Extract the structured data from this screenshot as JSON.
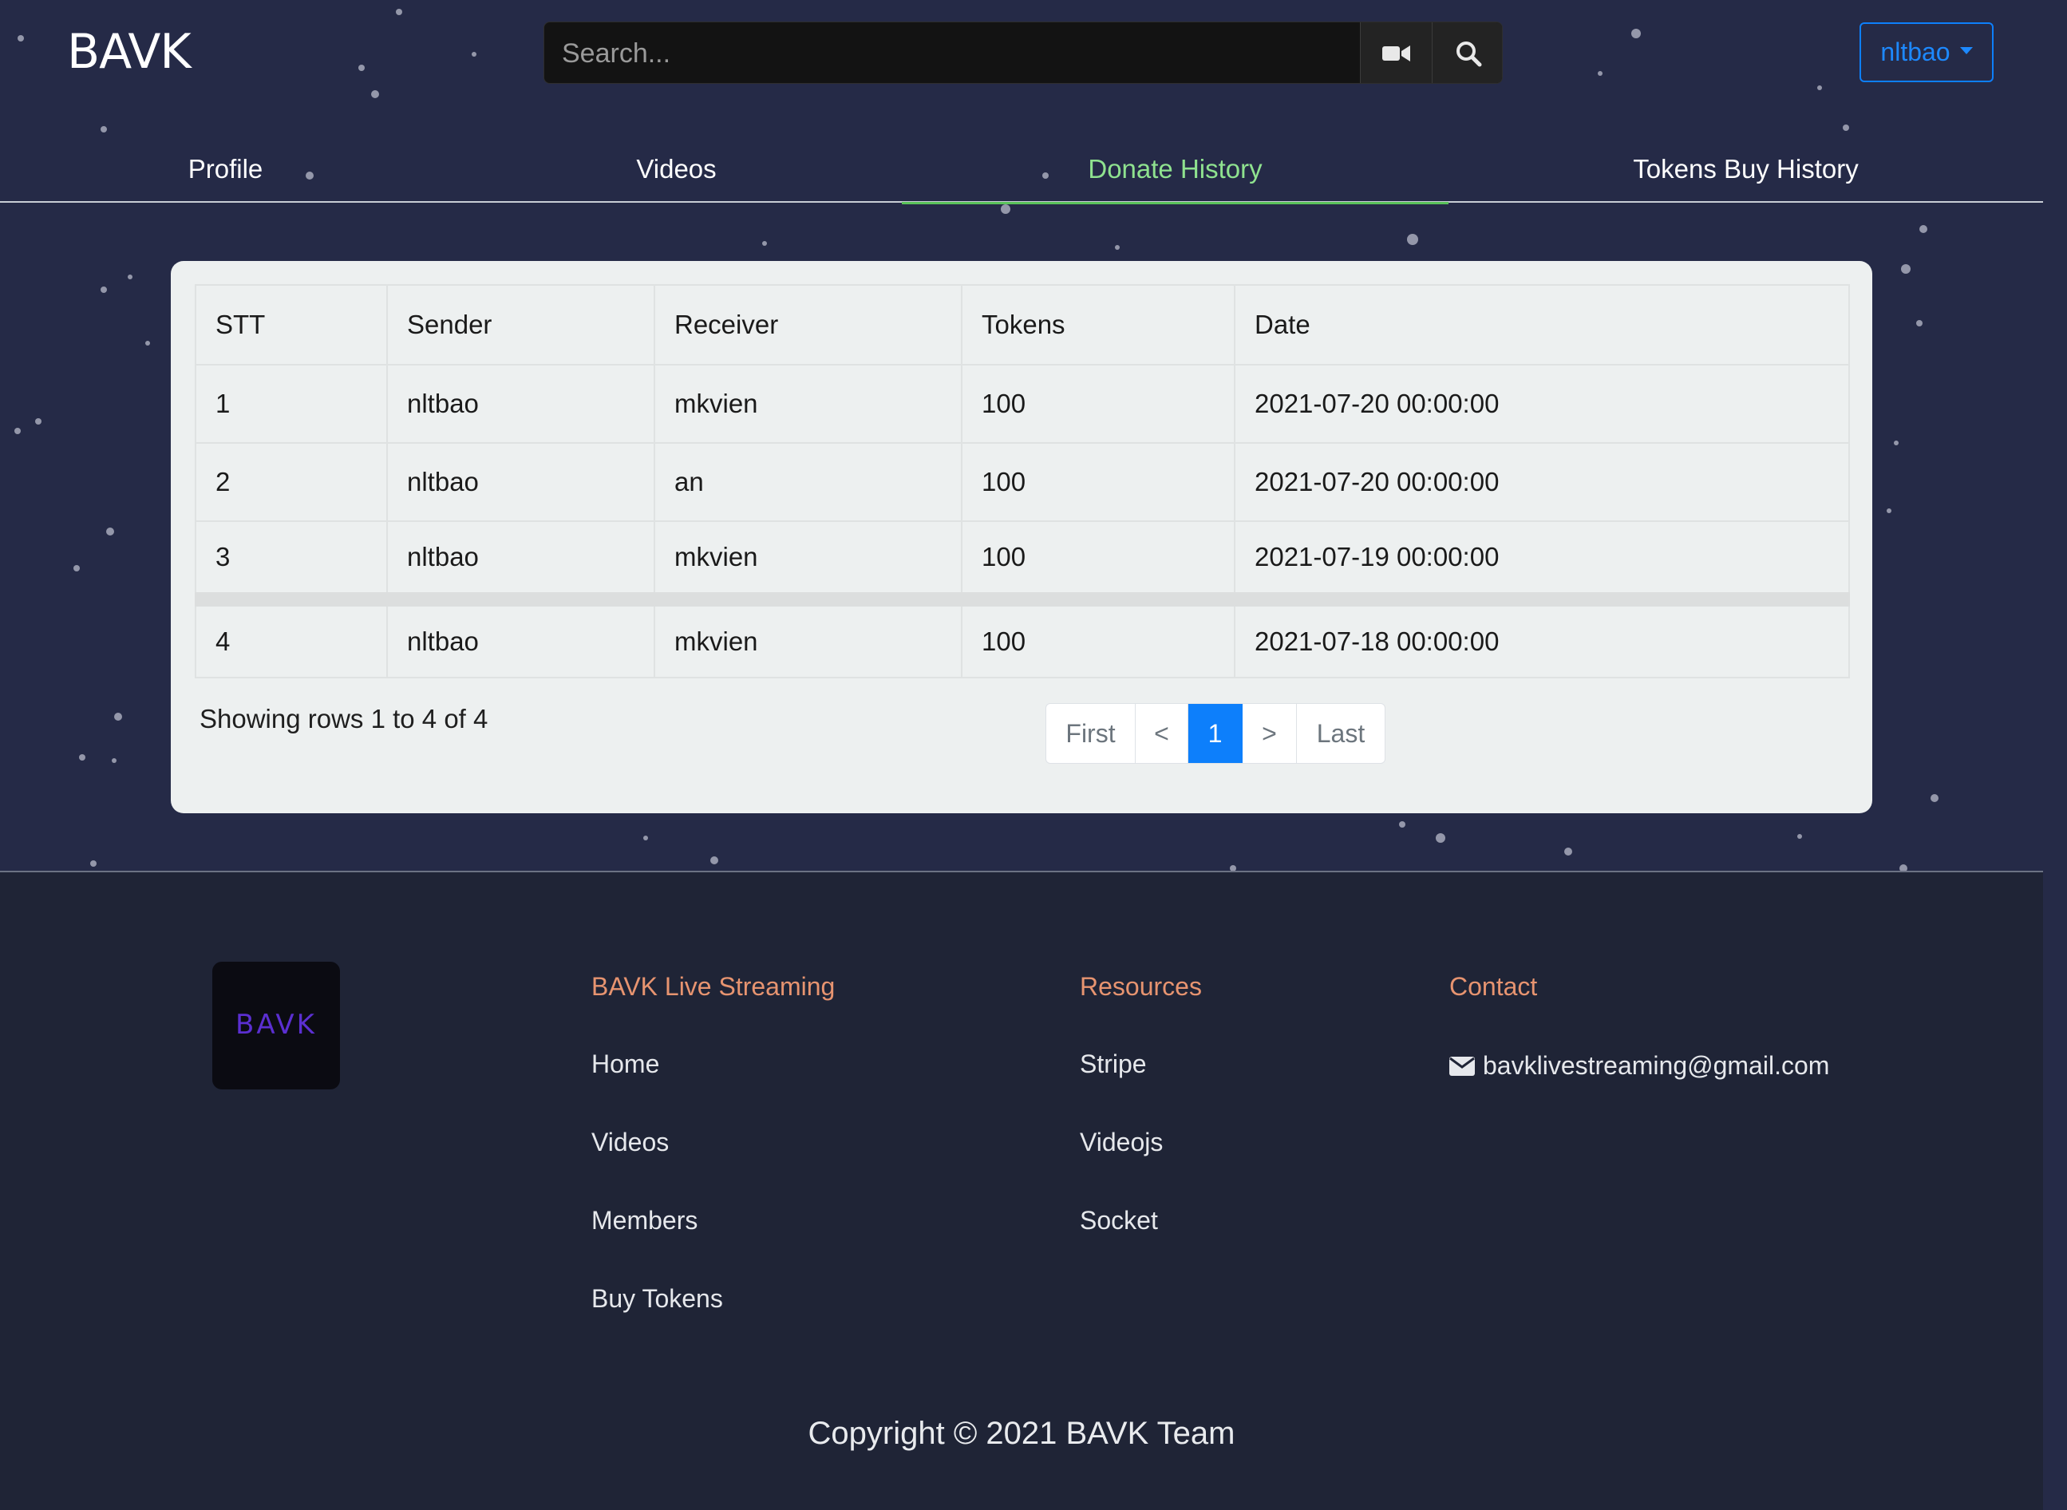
{
  "app": {
    "brand": "BAVK"
  },
  "search": {
    "placeholder": "Search..."
  },
  "user_menu": {
    "label": "nltbao"
  },
  "tabs": [
    {
      "label": "Profile"
    },
    {
      "label": "Videos"
    },
    {
      "label": "Donate History"
    },
    {
      "label": "Tokens Buy History"
    }
  ],
  "table": {
    "headers": [
      "STT",
      "Sender",
      "Receiver",
      "Tokens",
      "Date"
    ],
    "rows": [
      {
        "stt": "1",
        "sender": "nltbao",
        "receiver": "mkvien",
        "tokens": "100",
        "date": "2021-07-20 00:00:00"
      },
      {
        "stt": "2",
        "sender": "nltbao",
        "receiver": "an",
        "tokens": "100",
        "date": "2021-07-20 00:00:00"
      },
      {
        "stt": "3",
        "sender": "nltbao",
        "receiver": "mkvien",
        "tokens": "100",
        "date": "2021-07-19 00:00:00"
      },
      {
        "stt": "4",
        "sender": "nltbao",
        "receiver": "mkvien",
        "tokens": "100",
        "date": "2021-07-18 00:00:00"
      }
    ]
  },
  "summary": "Showing rows 1 to 4 of 4",
  "pagination": {
    "first": "First",
    "prev": "<",
    "current": "1",
    "next": ">",
    "last": "Last"
  },
  "footer": {
    "logo_text": "BAVK",
    "col1": {
      "title": "BAVK Live Streaming",
      "links": [
        "Home",
        "Videos",
        "Members",
        "Buy Tokens"
      ]
    },
    "col2": {
      "title": "Resources",
      "links": [
        "Stripe",
        "Videojs",
        "Socket"
      ]
    },
    "col3": {
      "title": "Contact",
      "email": "bavklivestreaming@gmail.com"
    },
    "copyright": "Copyright © 2021 BAVK Team"
  },
  "colors": {
    "background": "#252a47",
    "footer_background": "#1f2436",
    "active_tab": "#8fe28f",
    "accent_blue": "#0d7ffb",
    "footer_heading": "#e79470"
  },
  "icons": [
    "video-camera-icon",
    "search-icon",
    "caret-down-icon",
    "envelope-icon"
  ]
}
